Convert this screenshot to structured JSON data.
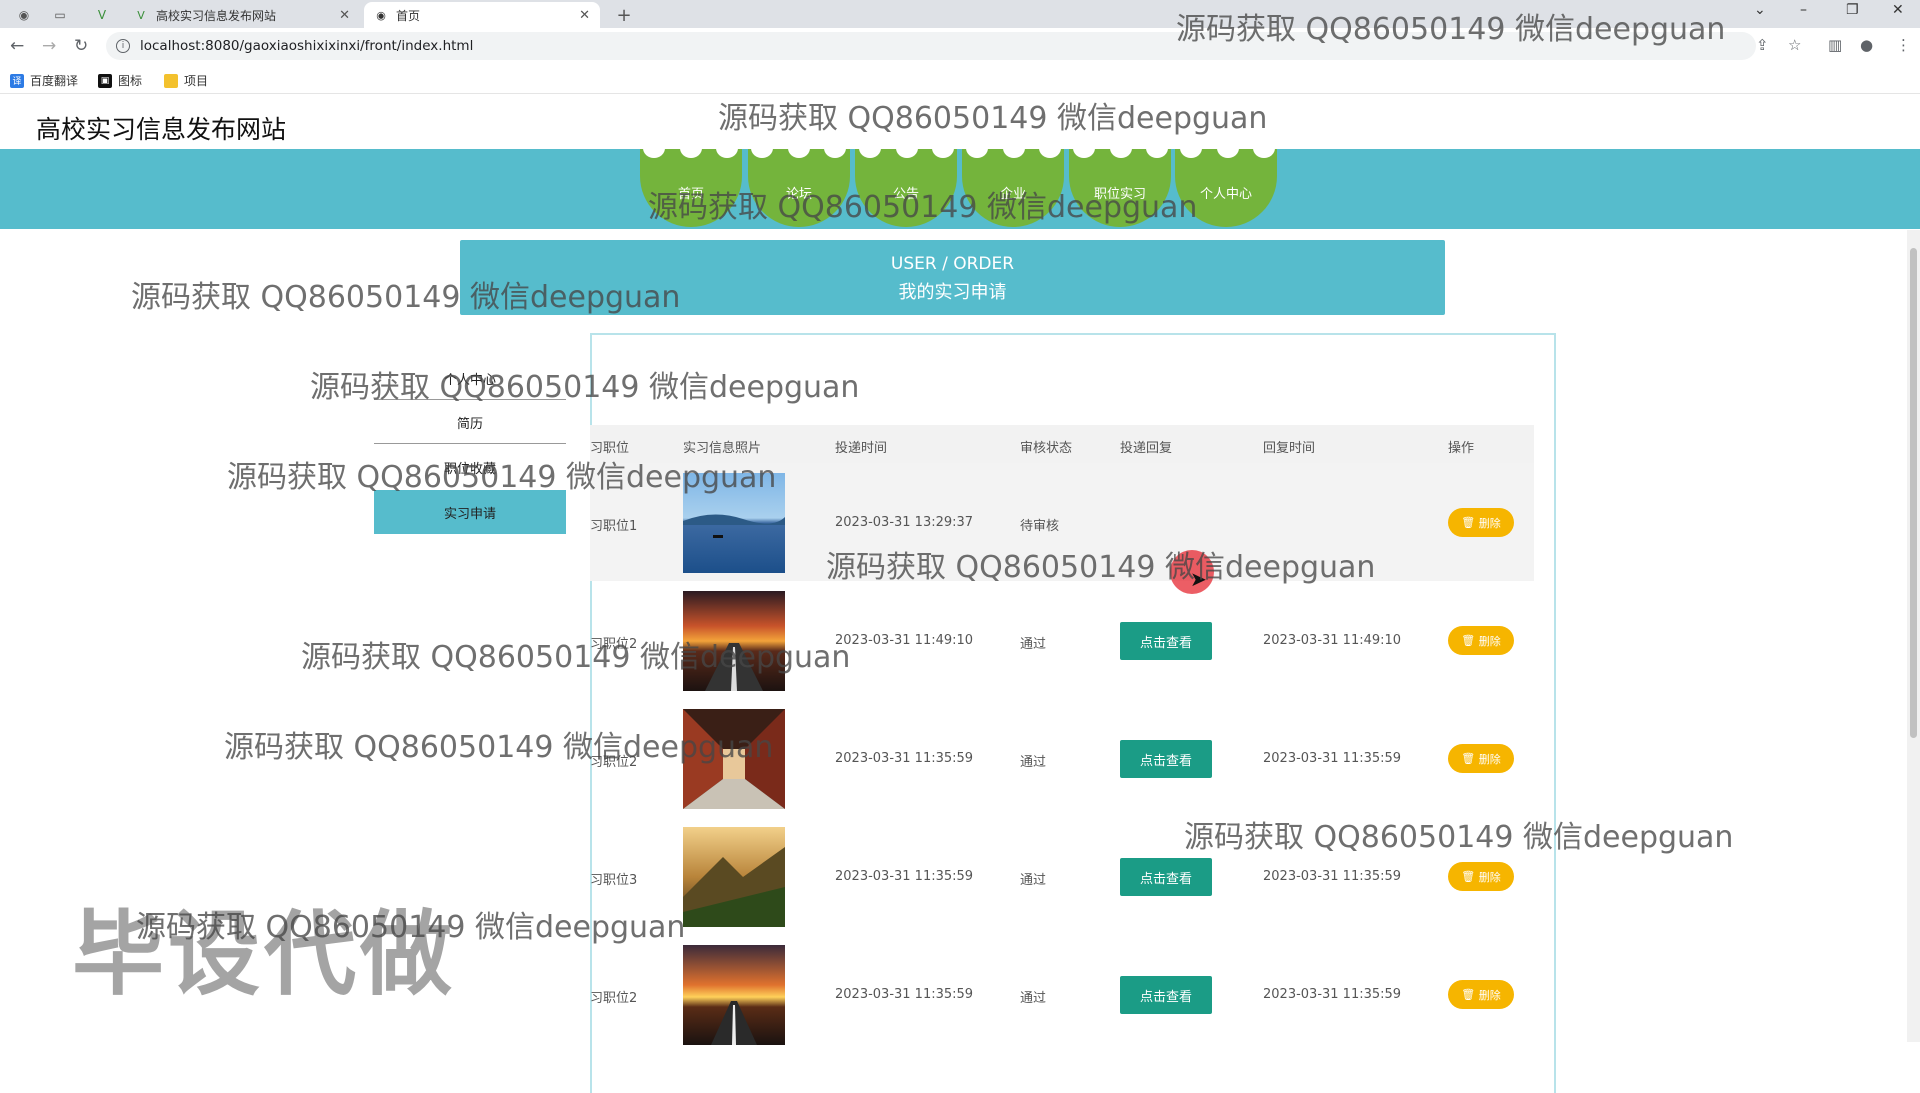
{
  "browser": {
    "tabs": [
      {
        "title": "高校实习信息发布网站",
        "active": false
      },
      {
        "title": "首页",
        "active": true
      }
    ],
    "url": "localhost:8080/gaoxiaoshixixinxi/front/index.html",
    "bookmarks": [
      "百度翻译",
      "图标",
      "项目"
    ]
  },
  "site": {
    "title": "高校实习信息发布网站",
    "nav": [
      "首页",
      "论坛",
      "公告",
      "企业",
      "职位实习",
      "个人中心"
    ]
  },
  "banner": {
    "en": "USER / ORDER",
    "cn": "我的实习申请"
  },
  "sidebar": {
    "items": [
      "个人中心",
      "简历",
      "职位收藏",
      "实习申请"
    ],
    "active": "实习申请"
  },
  "table": {
    "columns": [
      "习职位",
      "实习信息照片",
      "投递时间",
      "审核状态",
      "投递回复",
      "回复时间",
      "操作"
    ],
    "rows": [
      {
        "position": "习职位1",
        "time": "2023-03-31 13:29:37",
        "status": "待审核",
        "reply": "",
        "reply_time": "",
        "delete": "删除"
      },
      {
        "position": "习职位2",
        "time": "2023-03-31 11:49:10",
        "status": "通过",
        "reply": "点击查看",
        "reply_time": "2023-03-31 11:49:10",
        "delete": "删除"
      },
      {
        "position": "习职位2",
        "time": "2023-03-31 11:35:59",
        "status": "通过",
        "reply": "点击查看",
        "reply_time": "2023-03-31 11:35:59",
        "delete": "删除"
      },
      {
        "position": "习职位3",
        "time": "2023-03-31 11:35:59",
        "status": "通过",
        "reply": "点击查看",
        "reply_time": "2023-03-31 11:35:59",
        "delete": "删除"
      },
      {
        "position": "习职位2",
        "time": "2023-03-31 11:35:59",
        "status": "通过",
        "reply": "点击查看",
        "reply_time": "2023-03-31 11:35:59",
        "delete": "删除"
      }
    ]
  },
  "watermarks": {
    "text": "源码获取 QQ86050149 微信deepguan",
    "big": "毕设代做"
  },
  "colors": {
    "accent": "#56bccc",
    "nav_green": "#74b43c",
    "view_btn": "#1b9c86",
    "delete_btn": "#f6b500"
  }
}
